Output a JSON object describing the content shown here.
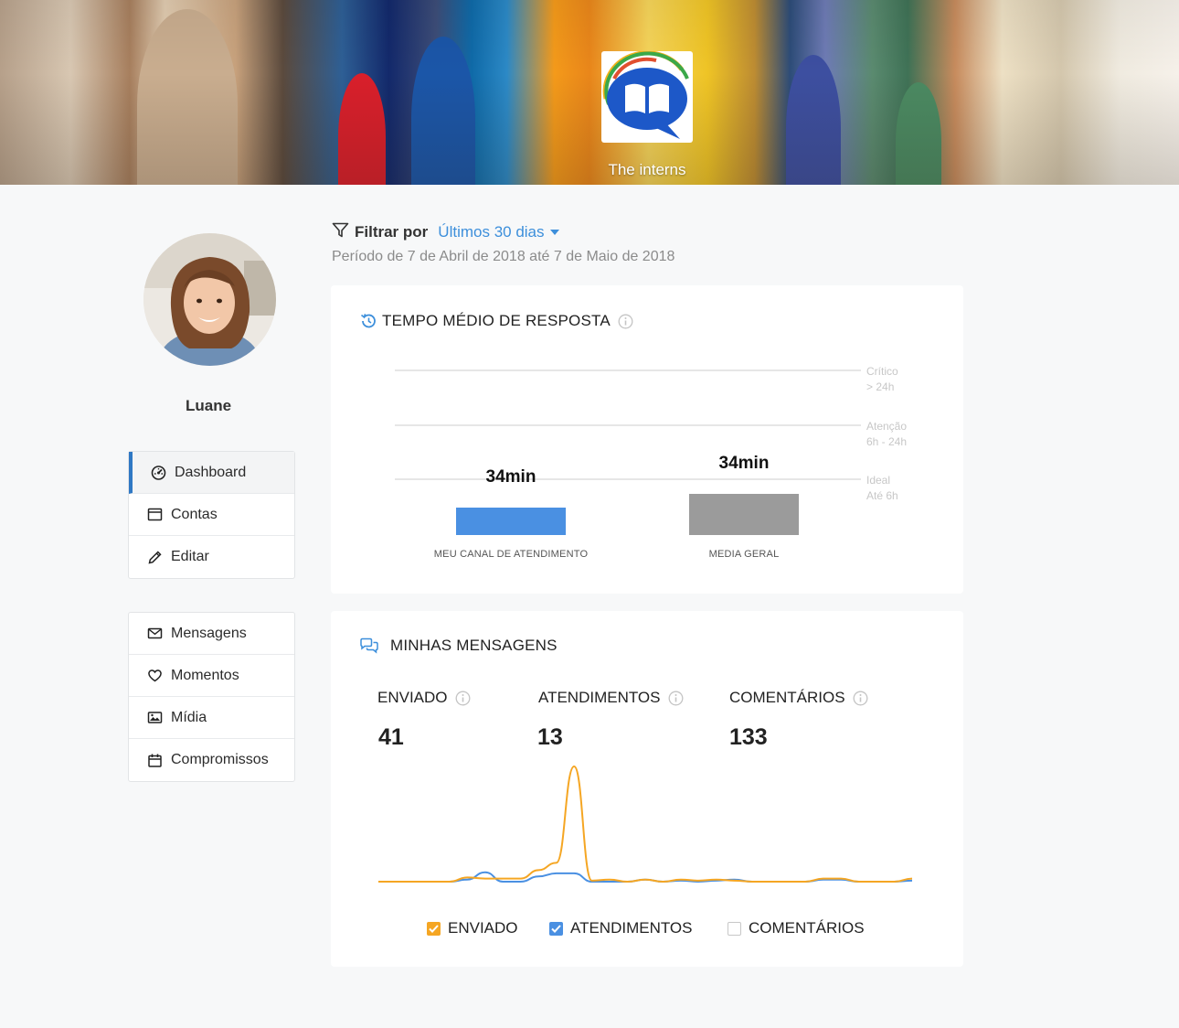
{
  "brand": {
    "name": "The interns"
  },
  "user": {
    "name": "Luane"
  },
  "menu_primary": [
    {
      "label": "Dashboard",
      "icon": "dashboard-icon",
      "active": true
    },
    {
      "label": "Contas",
      "icon": "window-icon"
    },
    {
      "label": "Editar",
      "icon": "pencil-icon"
    }
  ],
  "menu_secondary": [
    {
      "label": "Mensagens",
      "icon": "envelope-icon"
    },
    {
      "label": "Momentos",
      "icon": "heart-icon"
    },
    {
      "label": "Mídia",
      "icon": "image-icon"
    },
    {
      "label": "Compromissos",
      "icon": "calendar-icon"
    }
  ],
  "filter": {
    "label": "Filtrar por",
    "selected": "Últimos 30 dias",
    "period": "Período de 7 de Abril de 2018 até 7 de Maio de 2018"
  },
  "response_time": {
    "title": "TEMPO MÉDIO DE RESPOSTA",
    "thresholds": [
      {
        "line1": "Crítico",
        "line2": "> 24h"
      },
      {
        "line1": "Atenção",
        "line2": "6h - 24h"
      },
      {
        "line1": "Ideal",
        "line2": "Até 6h"
      }
    ],
    "bars": [
      {
        "value": "34min",
        "caption": "MEU CANAL DE ATENDIMENTO",
        "color": "#4a90e2"
      },
      {
        "value": "34min",
        "caption": "MEDIA GERAL",
        "color": "#9b9b9b"
      }
    ]
  },
  "messages": {
    "title": "MINHAS MENSAGENS",
    "stats": [
      {
        "label": "ENVIADO",
        "value": "41"
      },
      {
        "label": "ATENDIMENTOS",
        "value": "13"
      },
      {
        "label": "COMENTÁRIOS",
        "value": "133"
      }
    ],
    "legend": [
      {
        "label": "ENVIADO",
        "checked": true,
        "color": "#f5a623"
      },
      {
        "label": "ATENDIMENTOS",
        "checked": true,
        "color": "#4a90e2"
      },
      {
        "label": "COMENTÁRIOS",
        "checked": false,
        "color": "#c7c7c7"
      }
    ]
  },
  "chart_data": {
    "type": "line",
    "x": [
      1,
      2,
      3,
      4,
      5,
      6,
      7,
      8,
      9,
      10,
      11,
      12,
      13,
      14,
      15,
      16,
      17,
      18,
      19,
      20,
      21,
      22,
      23,
      24,
      25,
      26,
      27,
      28,
      29,
      30,
      31
    ],
    "series": [
      {
        "name": "ENVIADO",
        "color": "#f5a623",
        "values": [
          0,
          0,
          0,
          0,
          0,
          0.4,
          0.3,
          0.3,
          0.3,
          1.1,
          1.8,
          11,
          0.1,
          0.2,
          0,
          0.2,
          0,
          0.2,
          0.1,
          0.2,
          0.1,
          0,
          0,
          0,
          0,
          0.3,
          0.3,
          0,
          0,
          0,
          0.3
        ]
      },
      {
        "name": "ATENDIMENTOS",
        "color": "#4a90e2",
        "values": [
          0,
          0,
          0,
          0,
          0,
          0.2,
          0.9,
          0,
          0,
          0.5,
          0.8,
          0.8,
          0,
          0,
          0,
          0.2,
          0,
          0.1,
          0,
          0.1,
          0.2,
          0,
          0,
          0,
          0,
          0.2,
          0.2,
          0,
          0,
          0,
          0.1
        ]
      }
    ]
  }
}
